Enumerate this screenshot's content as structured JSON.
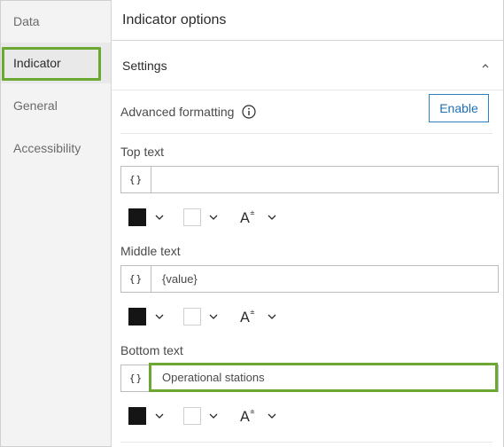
{
  "sidebar": {
    "items": [
      {
        "label": "Data"
      },
      {
        "label": "Indicator"
      },
      {
        "label": "General"
      },
      {
        "label": "Accessibility"
      }
    ]
  },
  "header": {
    "title": "Indicator options"
  },
  "settings": {
    "title": "Settings",
    "advanced_label": "Advanced formatting",
    "enable_label": "Enable"
  },
  "fields": [
    {
      "label": "Top text",
      "brace": "{}",
      "value": ""
    },
    {
      "label": "Middle text",
      "brace": "{}",
      "value": "{value}"
    },
    {
      "label": "Bottom text",
      "brace": "{}",
      "value": "Operational stations"
    }
  ],
  "colors": {
    "accent_green": "#6aa832",
    "enable_blue": "#2f7fbf",
    "text_color_swatch": "#151515",
    "background_swatch": "#ffffff"
  },
  "icons": {
    "collapse": "chevron-up-icon",
    "info": "info-icon",
    "font_size": "font-size-icon",
    "dropdown": "chevron-down-icon"
  }
}
